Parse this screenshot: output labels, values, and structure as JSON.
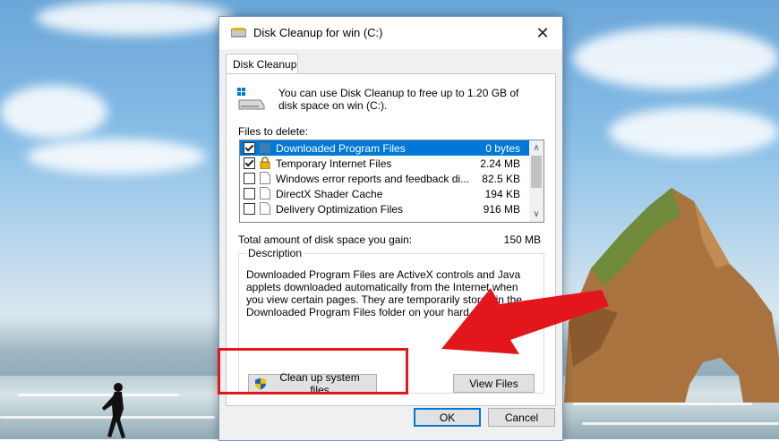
{
  "window": {
    "title": "Disk Cleanup for win (C:)",
    "close_glyph": "✕",
    "tab_label": "Disk Cleanup"
  },
  "intro_text": "You can use Disk Cleanup to free up to 1.20 GB of disk space on win (C:).",
  "files_to_delete_label": "Files to delete:",
  "files": [
    {
      "name": "Downloaded Program Files",
      "size": "0 bytes",
      "checked": true,
      "selected": true,
      "icon": "folder-icon"
    },
    {
      "name": "Temporary Internet Files",
      "size": "2.24 MB",
      "checked": true,
      "selected": false,
      "icon": "lock-icon"
    },
    {
      "name": "Windows error reports and feedback di...",
      "size": "82.5 KB",
      "checked": false,
      "selected": false,
      "icon": "file-icon"
    },
    {
      "name": "DirectX Shader Cache",
      "size": "194 KB",
      "checked": false,
      "selected": false,
      "icon": "file-icon"
    },
    {
      "name": "Delivery Optimization Files",
      "size": "916 MB",
      "checked": false,
      "selected": false,
      "icon": "file-icon"
    }
  ],
  "total_label": "Total amount of disk space you gain:",
  "total_value": "150 MB",
  "description": {
    "legend": "Description",
    "text": "Downloaded Program Files are ActiveX controls and Java applets downloaded automatically from the Internet when you view certain pages. They are temporarily stored in the Downloaded Program Files folder on your hard disk."
  },
  "buttons": {
    "cleanup_system": "Clean up system files",
    "view_files": "View Files",
    "ok": "OK",
    "cancel": "Cancel"
  },
  "icons": {
    "scroll_up": "∧",
    "scroll_down": "∨"
  },
  "colors": {
    "selection": "#0078d7",
    "annotation_red": "#e3161c"
  }
}
